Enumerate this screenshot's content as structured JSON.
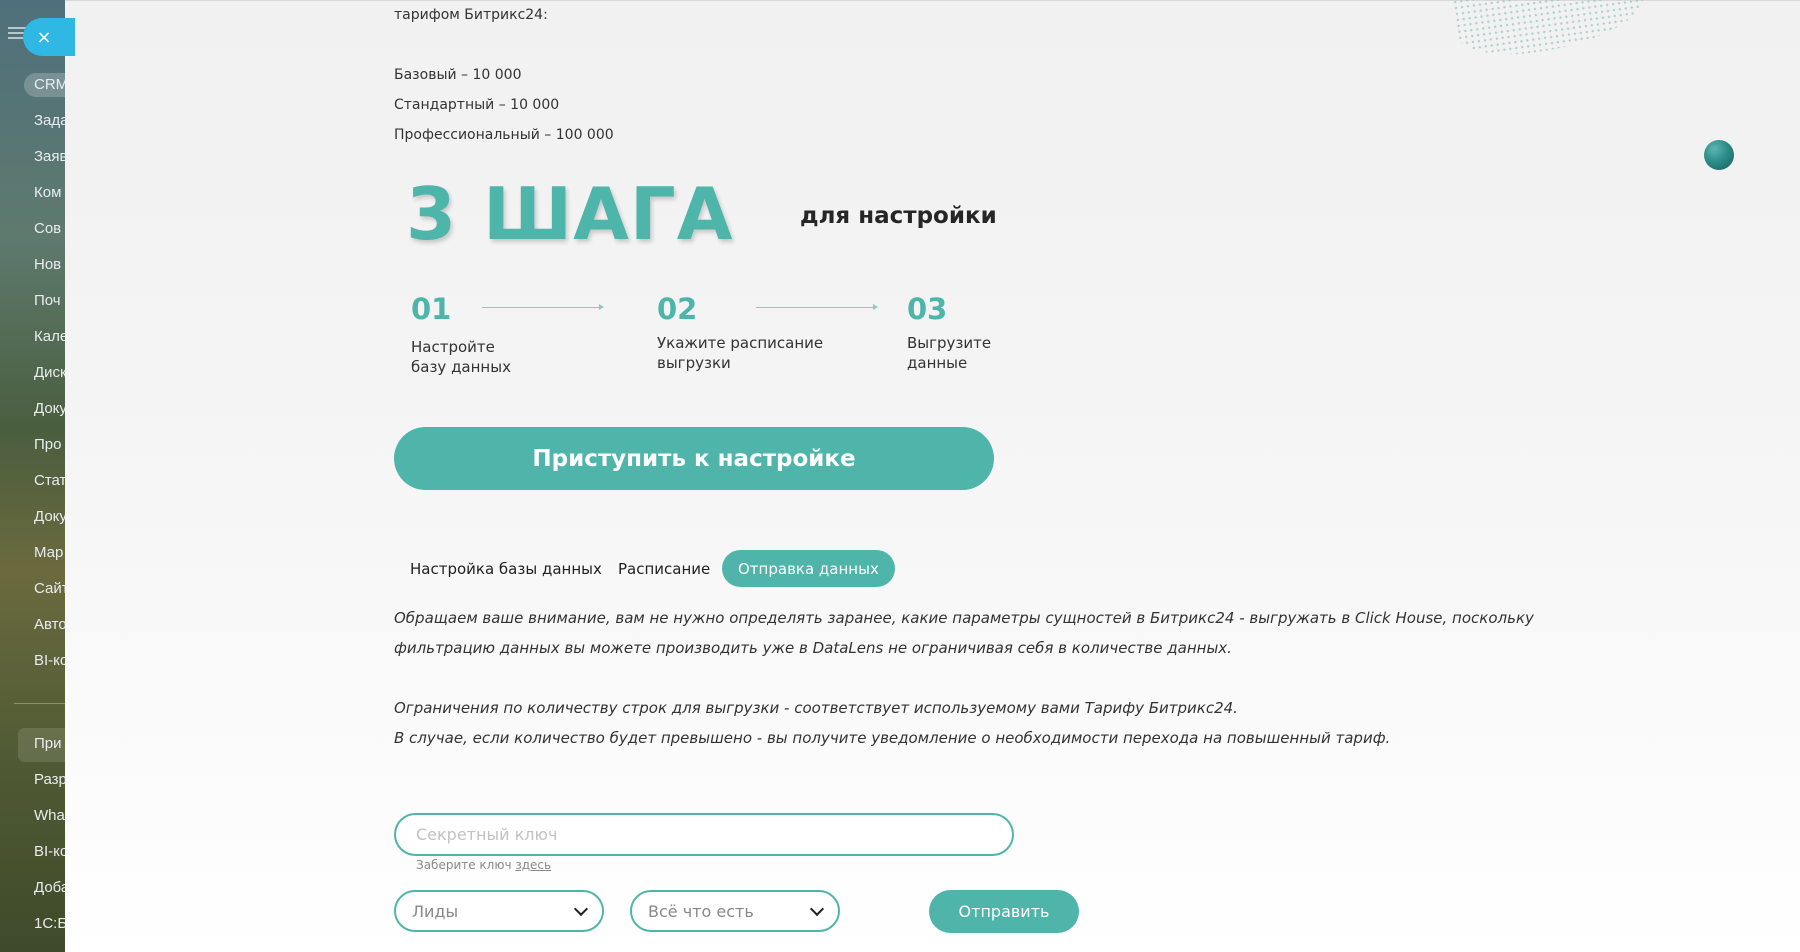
{
  "sidebar": {
    "crm": "CRM",
    "items": [
      "Зада",
      "Заяв",
      "Ком",
      "Сов",
      "Нов",
      "Поч",
      "Кале",
      "Диск",
      "Доку",
      "Про",
      "Стат",
      "Доку",
      "Мар",
      "Сайт",
      "Авто",
      "BI-ко"
    ],
    "apps": [
      "При",
      "Разр",
      "Wha",
      "BI-ко",
      "Доба",
      "1С:Б"
    ]
  },
  "close_label": "×",
  "intro": {
    "lines": [
      "тарифом Битрикс24:",
      "Базовый – 10 000",
      "Стандартный – 10 000",
      "Профессиональный – 100 000"
    ]
  },
  "hero": {
    "title": "3 ШАГА",
    "subtitle": "для настройки"
  },
  "steps": [
    {
      "num": "01",
      "line1": "Настройте",
      "line2": "базу данных"
    },
    {
      "num": "02",
      "line1": "Укажите расписание",
      "line2": "выгрузки"
    },
    {
      "num": "03",
      "line1": "Выгрузите",
      "line2": "данные"
    }
  ],
  "cta_label": "Приступить к настройке",
  "tabs": [
    {
      "label": "Настройка базы данных",
      "active": false
    },
    {
      "label": "Расписание",
      "active": false
    },
    {
      "label": "Отправка данных",
      "active": true
    }
  ],
  "notes": [
    "Обращаем ваше внимание, вам не нужно определять заранее, какие параметры сущностей в Битрикс24 - выгружать в Click House, поскольку",
    "фильтрацию данных вы можете производить уже в DataLens не ограничивая себя в количестве данных.",
    "Ограничения по количеству строк для выгрузки - соответствует используемому вами Тарифу Битрикс24.",
    "В случае, если количество будет превышено - вы получите уведомление о необходимости перехода на повышенный тариф."
  ],
  "form": {
    "key_placeholder": "Секретный ключ",
    "hint_text": "Заберите ключ ",
    "hint_link": "здесь",
    "entity_select": "Лиды",
    "scope_select": "Всё что есть",
    "send_label": "Отправить"
  },
  "colors": {
    "accent": "#4fb5ab",
    "close": "#2fb8e3"
  }
}
